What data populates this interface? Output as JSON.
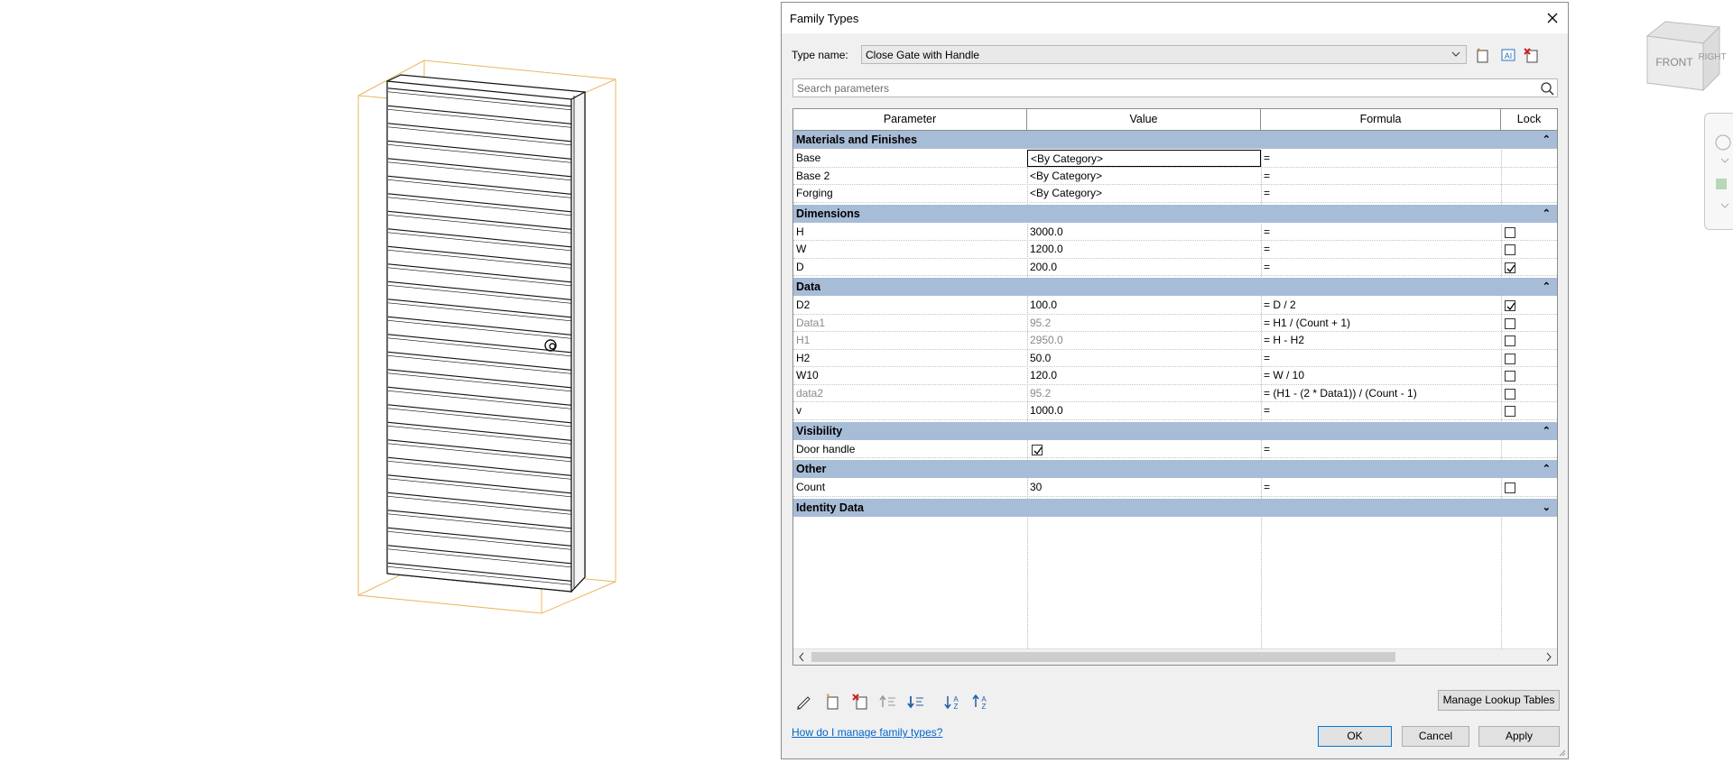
{
  "dialog": {
    "title": "Family Types",
    "type_name_label": "Type name:",
    "type_name_value": "Close Gate with Handle",
    "search_placeholder": "Search parameters",
    "columns": [
      "Parameter",
      "Value",
      "Formula",
      "Lock"
    ],
    "groups": [
      {
        "label": "Materials and Finishes",
        "state": "expanded",
        "rows": [
          {
            "param": "Base",
            "value": "<By Category>",
            "formula": "=",
            "lock": null,
            "dim": false
          },
          {
            "param": "Base 2",
            "value": "<By Category>",
            "formula": "=",
            "lock": null,
            "dim": false
          },
          {
            "param": "Forging",
            "value": "<By Category>",
            "formula": "=",
            "lock": null,
            "dim": false
          }
        ]
      },
      {
        "label": "Dimensions",
        "state": "expanded",
        "rows": [
          {
            "param": "H",
            "value": "3000.0",
            "formula": "=",
            "lock": false,
            "dim": false
          },
          {
            "param": "W",
            "value": "1200.0",
            "formula": "=",
            "lock": false,
            "dim": false
          },
          {
            "param": "D",
            "value": "200.0",
            "formula": "=",
            "lock": true,
            "dim": false
          }
        ]
      },
      {
        "label": "Data",
        "state": "expanded",
        "rows": [
          {
            "param": "D2",
            "value": "100.0",
            "formula": "= D / 2",
            "lock": true,
            "dim": false
          },
          {
            "param": "Data1",
            "value": "95.2",
            "formula": "= H1 / (Count + 1)",
            "lock": false,
            "dim": true
          },
          {
            "param": "H1",
            "value": "2950.0",
            "formula": "= H - H2",
            "lock": false,
            "dim": true
          },
          {
            "param": "H2",
            "value": "50.0",
            "formula": "=",
            "lock": false,
            "dim": false
          },
          {
            "param": "W10",
            "value": "120.0",
            "formula": "= W / 10",
            "lock": false,
            "dim": false
          },
          {
            "param": "data2",
            "value": "95.2",
            "formula": "= (H1 - (2 * Data1)) / (Count - 1)",
            "lock": false,
            "dim": true
          },
          {
            "param": "v",
            "value": "1000.0",
            "formula": "=",
            "lock": false,
            "dim": false
          }
        ]
      },
      {
        "label": "Visibility",
        "state": "expanded",
        "rows": [
          {
            "param": "Door handle",
            "value_checkbox": true,
            "formula": "=",
            "lock": null,
            "dim": false
          }
        ]
      },
      {
        "label": "Other",
        "state": "expanded",
        "rows": [
          {
            "param": "Count",
            "value": "30",
            "formula": "=",
            "lock": false,
            "dim": false
          }
        ]
      },
      {
        "label": "Identity Data",
        "state": "collapsed",
        "rows": []
      }
    ],
    "buttons": {
      "manage_lookup": "Manage Lookup Tables",
      "ok": "OK",
      "cancel": "Cancel",
      "apply": "Apply"
    },
    "help_link": "How do I manage family types?",
    "toolbar_icons": [
      "new-type-icon",
      "rename-type-icon",
      "delete-type-icon"
    ],
    "bottom_icons": [
      "edit-parameter-icon",
      "new-parameter-icon",
      "delete-parameter-icon",
      "move-up-icon",
      "move-down-icon",
      "sort-ascending-icon",
      "sort-descending-icon"
    ]
  },
  "viewcube": {
    "face_label": "FRONT",
    "side_label": "RIGHT"
  },
  "colors": {
    "group_header": "#a7bcd7",
    "selection_orange": "#e8b860",
    "link": "#0066cc"
  }
}
